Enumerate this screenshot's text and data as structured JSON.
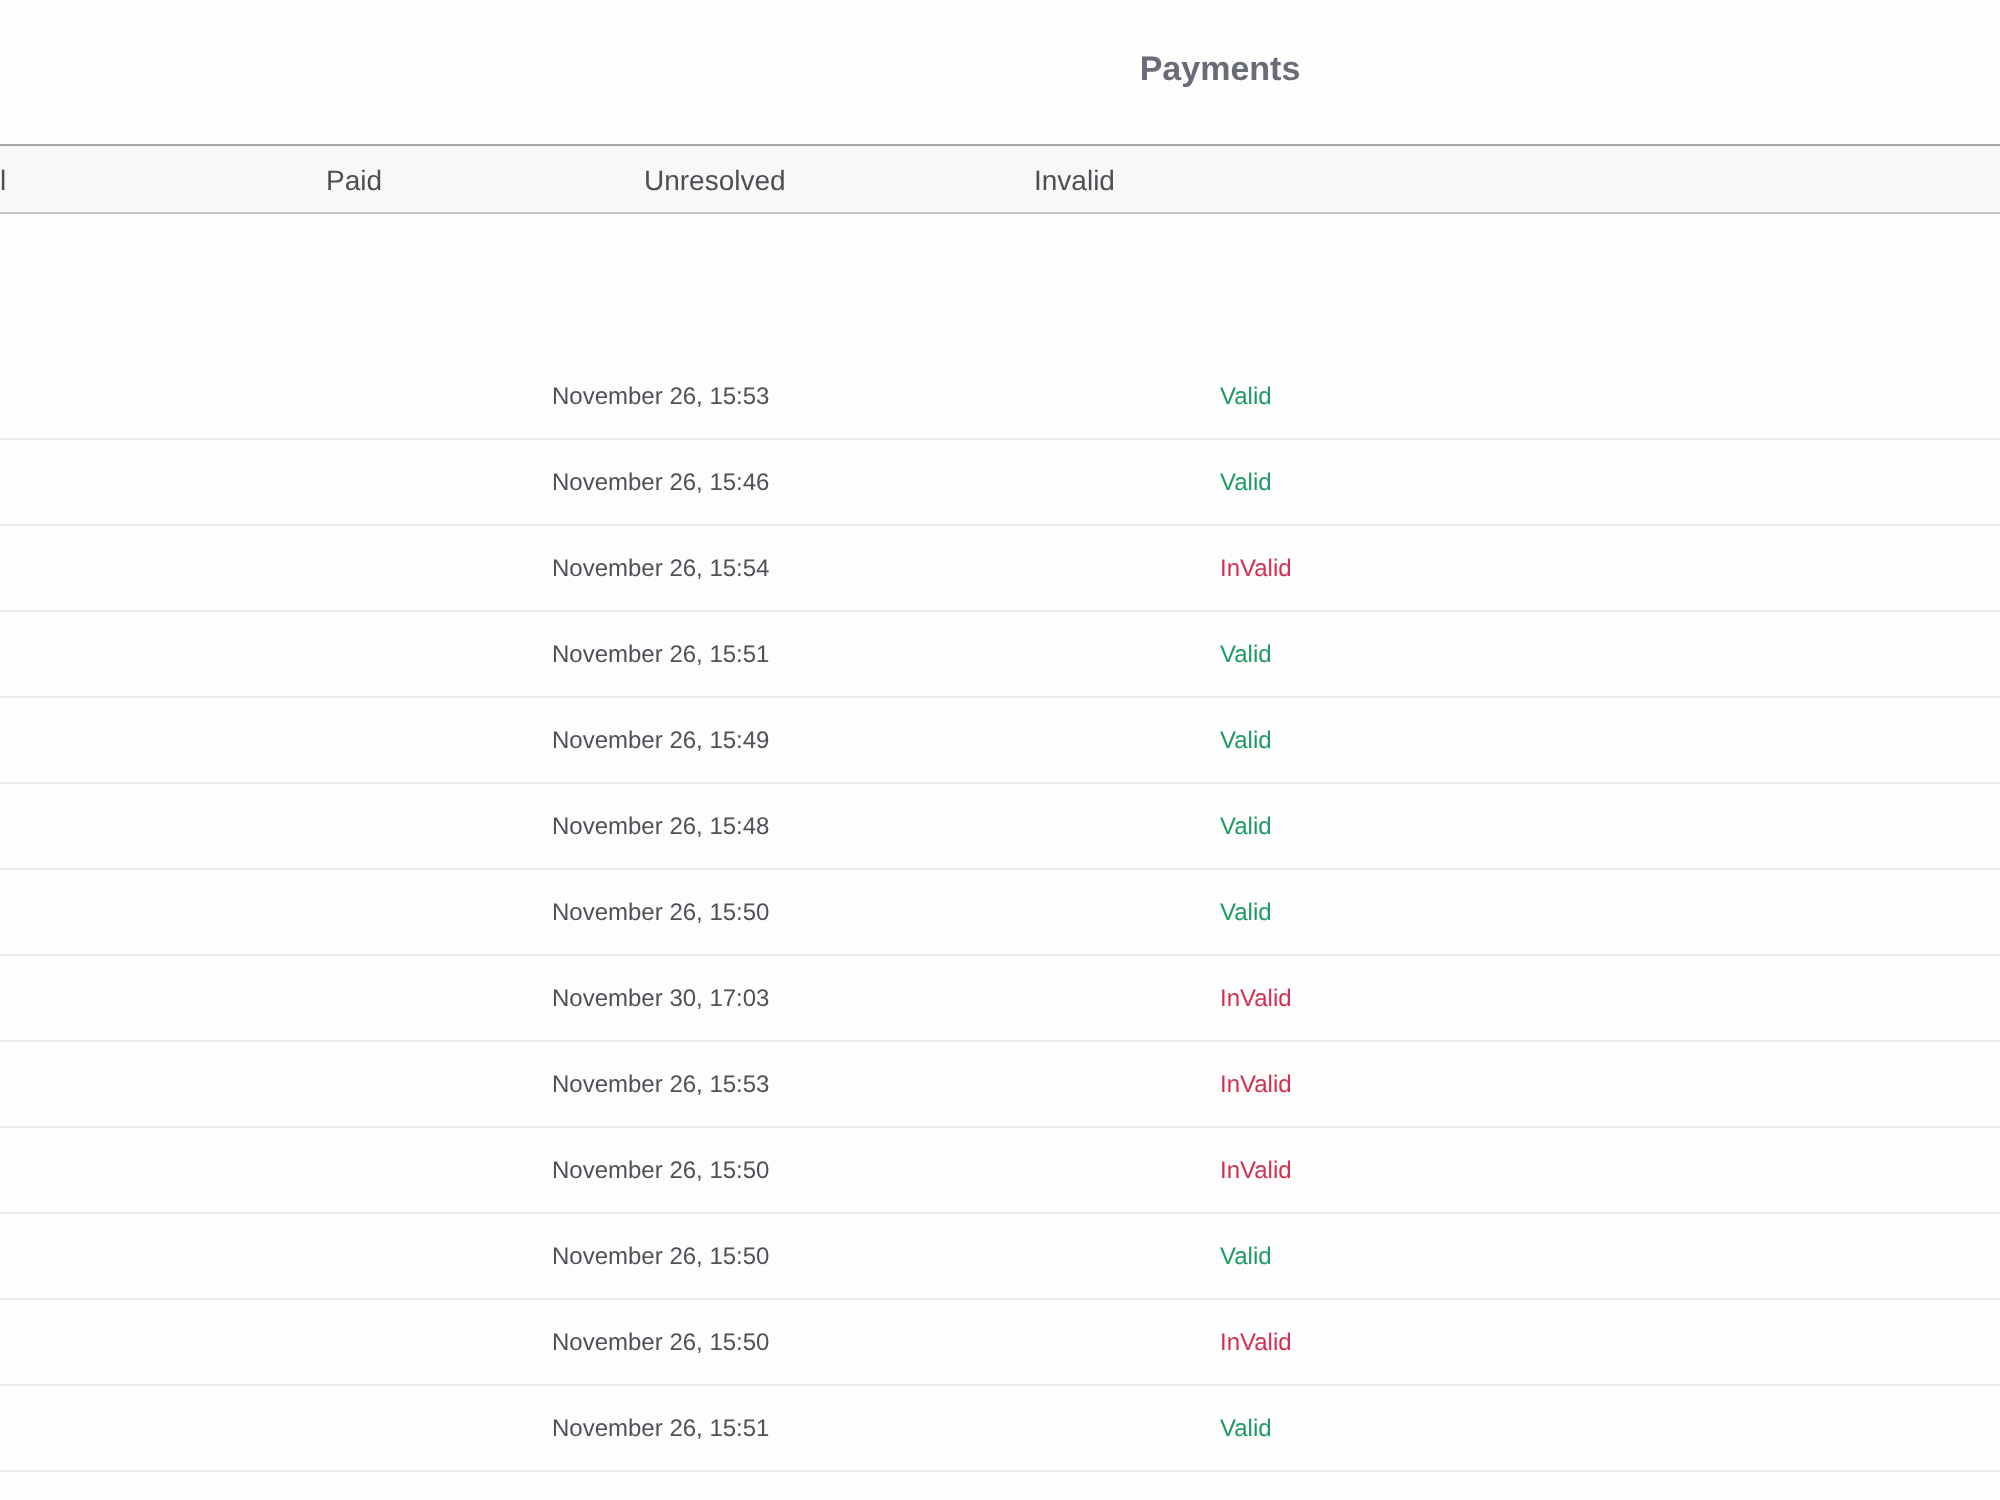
{
  "page": {
    "title": "Payments"
  },
  "tabs": [
    {
      "label": "l"
    },
    {
      "label": "Paid"
    },
    {
      "label": "Unresolved"
    },
    {
      "label": "Invalid"
    }
  ],
  "rows": [
    {
      "date": "November 26, 15:53",
      "status": "Valid",
      "valid": true
    },
    {
      "date": "November 26, 15:46",
      "status": "Valid",
      "valid": true
    },
    {
      "date": "November 26, 15:54",
      "status": "InValid",
      "valid": false
    },
    {
      "date": "November 26, 15:51",
      "status": "Valid",
      "valid": true
    },
    {
      "date": "November 26, 15:49",
      "status": "Valid",
      "valid": true
    },
    {
      "date": "November 26, 15:48",
      "status": "Valid",
      "valid": true
    },
    {
      "date": "November 26, 15:50",
      "status": "Valid",
      "valid": true
    },
    {
      "date": "November 30, 17:03",
      "status": "InValid",
      "valid": false
    },
    {
      "date": "November 26, 15:53",
      "status": "InValid",
      "valid": false
    },
    {
      "date": "November 26, 15:50",
      "status": "InValid",
      "valid": false
    },
    {
      "date": "November 26, 15:50",
      "status": "Valid",
      "valid": true
    },
    {
      "date": "November 26, 15:50",
      "status": "InValid",
      "valid": false
    },
    {
      "date": "November 26, 15:51",
      "status": "Valid",
      "valid": true
    }
  ]
}
